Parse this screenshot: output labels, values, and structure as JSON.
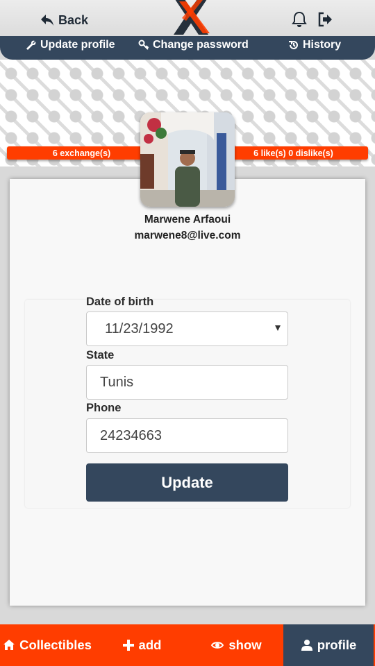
{
  "header": {
    "back_label": "Back"
  },
  "subnav": {
    "update_profile": "Update profile",
    "change_password": "Change password",
    "history": "History"
  },
  "stats": {
    "exchanges": "6 exchange(s)",
    "likes": "6 like(s) 0 dislike(s)"
  },
  "profile": {
    "name": "Marwene Arfaoui",
    "email": "marwene8@live.com"
  },
  "form": {
    "dob_label": "Date of birth",
    "dob_value": "11/23/1992",
    "state_label": "State",
    "state_value": "Tunis",
    "phone_label": "Phone",
    "phone_value": "24234663",
    "update_label": "Update"
  },
  "bottom_nav": {
    "collectibles": "Collectibles",
    "add": "add",
    "show": "show",
    "profile": "profile"
  },
  "colors": {
    "navy": "#34475d",
    "orange": "#ff3d00"
  },
  "icons": [
    "back-arrow-icon",
    "bell-icon",
    "logout-icon",
    "wrench-icon",
    "key-icon",
    "history-icon",
    "home-icon",
    "plus-icon",
    "eye-icon",
    "user-icon"
  ]
}
